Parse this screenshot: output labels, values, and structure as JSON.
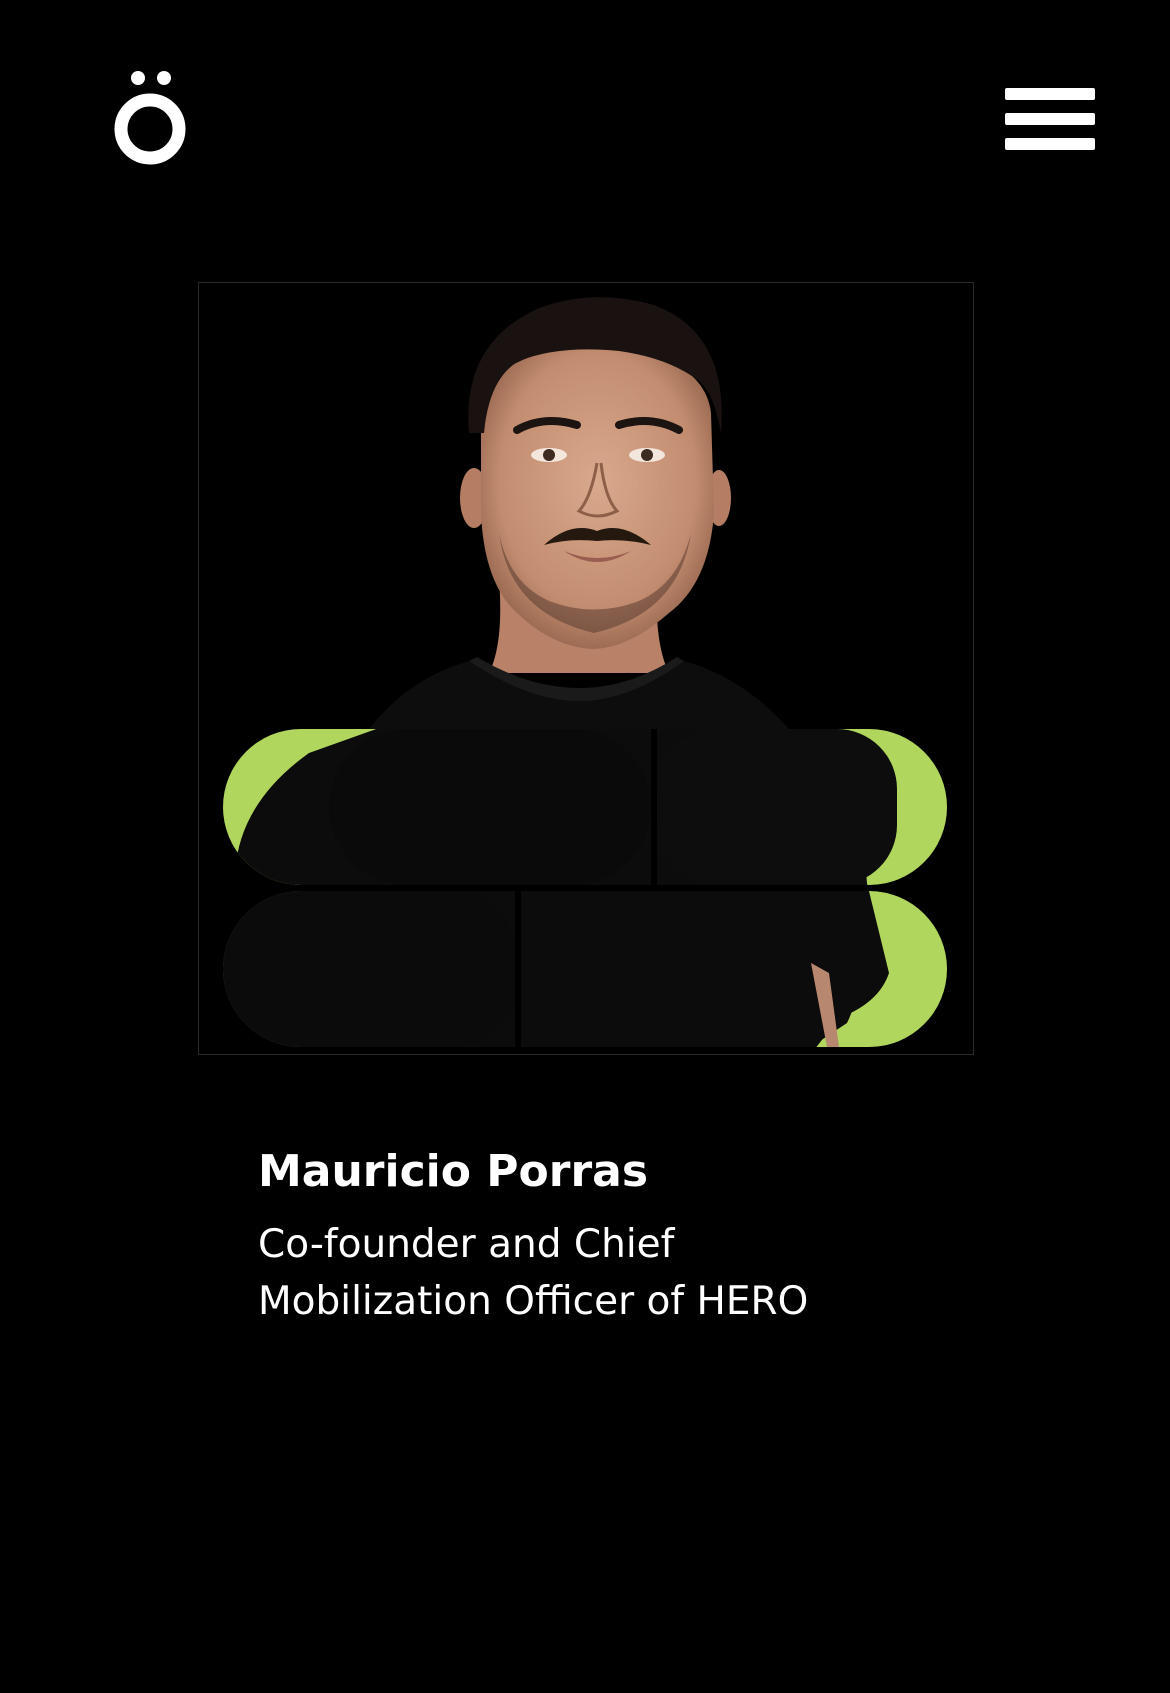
{
  "header": {
    "logo_icon": "o-umlaut-logo",
    "menu_icon": "hamburger-menu-icon"
  },
  "profile": {
    "photo_alt": "Mauricio Porras",
    "name": "Mauricio Porras",
    "role_line1": "Co-founder and Chief",
    "role_line2": "Mobilization Officer of HERO"
  },
  "colors": {
    "background": "#000000",
    "text": "#ffffff",
    "accent_green": "#b0d65d",
    "shirt": "#0b0b0b",
    "skin": "#c9957a"
  }
}
